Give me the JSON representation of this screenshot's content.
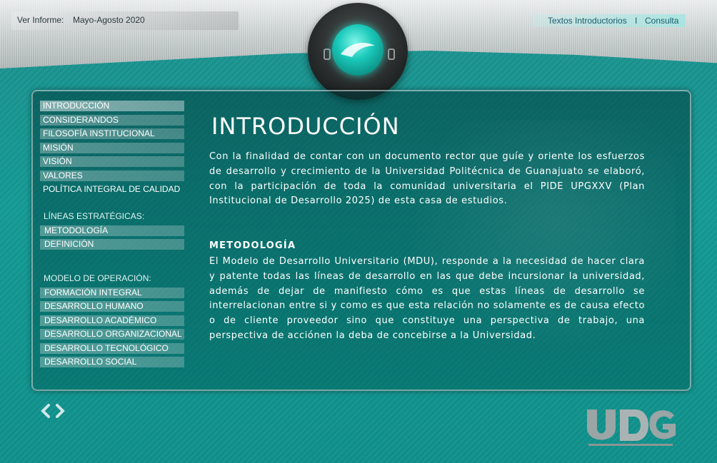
{
  "header": {
    "report_label": "Ver Informe:",
    "report_value": "Mayo-Agosto 2020",
    "links": [
      "Textos Introductorios",
      "I",
      "Consulta"
    ]
  },
  "menu": {
    "items": [
      "INTRODUCCIÓN",
      "CONSIDERANDOS",
      "FILOSOFÍA INSTITUCIONAL",
      "MISIÓN",
      "VISIÓN",
      "VALORES",
      "POLÍTICA INTEGRAL DE CALIDAD"
    ],
    "strategic_heading": "LÍNEAS ESTRATÉGICAS:",
    "strategic_items": [
      "METODOLOGÍA",
      "DEFINICIÓN"
    ],
    "operation_heading": "MODELO DE OPERACIÓN:",
    "operation_items": [
      "FORMACIÓN INTEGRAL",
      "DESARROLLO HUMANO",
      "DESARROLLO ACADÉMICO",
      "DESARROLLO ORGANIZACIONAL",
      "DESARROLLO TECNOLÓGICO",
      "DESARROLLO SOCIAL"
    ]
  },
  "content": {
    "title": "INTRODUCCIÓN",
    "intro": "Con la finalidad de contar con un documento rector que guíe y oriente los esfuerzos de desarrollo y crecimiento de la Universidad Politécnica de Guanajuato se elaboró, con la participación de toda la comunidad universitaria el PIDE UPGXXV (Plan Institucional de Desarrollo 2025) de esta casa de estudios.",
    "subheading": "METODOLOGÍA",
    "body": "El Modelo de Desarrollo Universitario (MDU), responde a la necesidad de hacer clara y patente todas las líneas de desarrollo en las que debe incursionar la universidad, además de dejar de manifiesto cómo es que estas líneas de desarrollo se interrelacionan entre si y como es que esta relación no solamente es de causa efecto o de cliente proveedor sino que constituye una perspectiva de trabajo, una perspectiva de acciónen la deba de concebirse a la Universidad."
  },
  "colors": {
    "accent": "#139893",
    "panel": "#0a5a57"
  }
}
